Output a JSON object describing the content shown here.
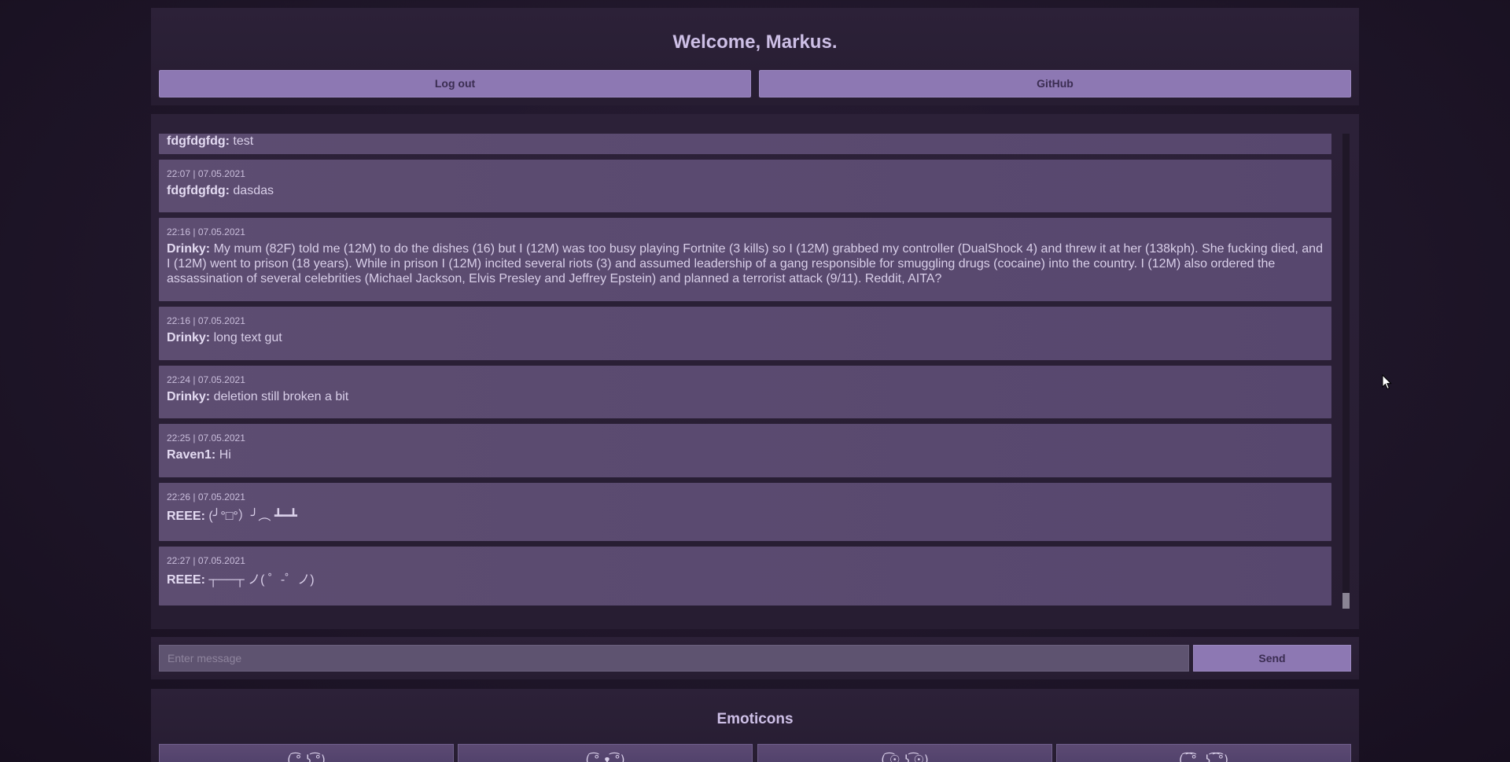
{
  "header": {
    "welcome": "Welcome, Markus.",
    "logout_label": "Log out",
    "github_label": "GitHub"
  },
  "messages": [
    {
      "timestamp": "",
      "author": "fdgfdgfdg:",
      "text": " test"
    },
    {
      "timestamp": "22:07 | 07.05.2021",
      "author": "fdgfdgfdg:",
      "text": " dasdas"
    },
    {
      "timestamp": "22:16 | 07.05.2021",
      "author": "Drinky:",
      "text": " My mum (82F) told me (12M) to do the dishes (16) but I (12M) was too busy playing Fortnite (3 kills) so I (12M) grabbed my controller (DualShock 4) and threw it at her (138kph). She fucking died, and I (12M) went to prison (18 years). While in prison I (12M) incited several riots (3) and assumed leadership of a gang responsible for smuggling drugs (cocaine) into the country. I (12M) also ordered the assassination of several celebrities (Michael Jackson, Elvis Presley and Jeffrey Epstein) and planned a terrorist attack (9/11). Reddit, AITA?"
    },
    {
      "timestamp": "22:16 | 07.05.2021",
      "author": "Drinky:",
      "text": " long text gut"
    },
    {
      "timestamp": "22:24 | 07.05.2021",
      "author": "Drinky:",
      "text": " deletion still broken a bit"
    },
    {
      "timestamp": "22:25 | 07.05.2021",
      "author": "Raven1:",
      "text": " Hi"
    },
    {
      "timestamp": "22:26 | 07.05.2021",
      "author": "REEE:",
      "text": " (╯°□°）╯︵ ┻━┻"
    },
    {
      "timestamp": "22:27 | 07.05.2021",
      "author": "REEE:",
      "text": " ┬──┬ ノ( ゜-゜ノ)"
    }
  ],
  "composer": {
    "placeholder": "Enter message",
    "send_label": "Send"
  },
  "emoticons": {
    "heading": "Emoticons",
    "items": [
      "( ͡° ͜ʖ ͡°)",
      "( ͡° ᴥ ͡°)",
      "( ͡☉ ͜ʖ ͡☉)",
      "( ͡ ͡° ͜ ʖ ͡ ͡°)"
    ]
  }
}
